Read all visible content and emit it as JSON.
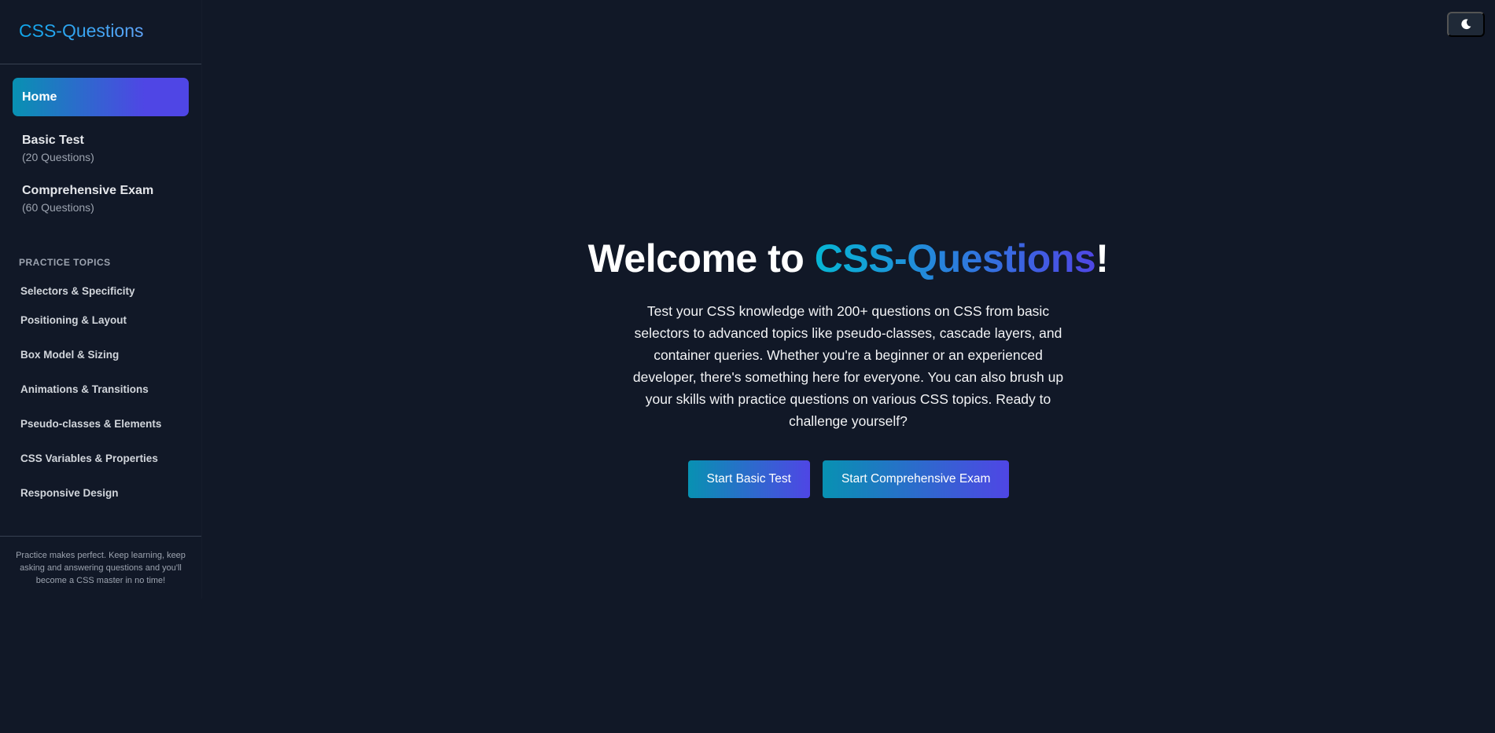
{
  "sidebar": {
    "brand": "CSS-Questions",
    "nav": [
      {
        "label": "Home"
      },
      {
        "label": "Basic Test",
        "sub": "(20 Questions)"
      },
      {
        "label": "Comprehensive Exam",
        "sub": "(60 Questions)"
      }
    ],
    "topics_heading": "PRACTICE TOPICS",
    "topics": [
      "Selectors & Specificity",
      "Positioning & Layout",
      "Box Model & Sizing",
      "Animations & Transitions",
      "Pseudo-classes & Elements",
      "CSS Variables & Properties",
      "Responsive Design"
    ],
    "footer": "Practice makes perfect. Keep learning, keep asking and answering questions and you'll become a CSS master in no time!"
  },
  "header": {
    "theme_toggle_icon": "moon-icon"
  },
  "hero": {
    "title_prefix": "Welcome to ",
    "title_accent": "CSS-Questions",
    "title_suffix": "!",
    "description": "Test your CSS knowledge with 200+ questions on CSS from basic selectors to advanced topics like pseudo-classes, cascade layers, and container queries. Whether you're a beginner or an experienced developer, there's something here for everyone. You can also brush up your skills with practice questions on various CSS topics. Ready to challenge yourself?",
    "primary_button": "Start Basic Test",
    "secondary_button": "Start Comprehensive Exam"
  },
  "colors": {
    "background": "#111827",
    "accent_start": "#0891b2",
    "accent_end": "#4f46e5"
  }
}
